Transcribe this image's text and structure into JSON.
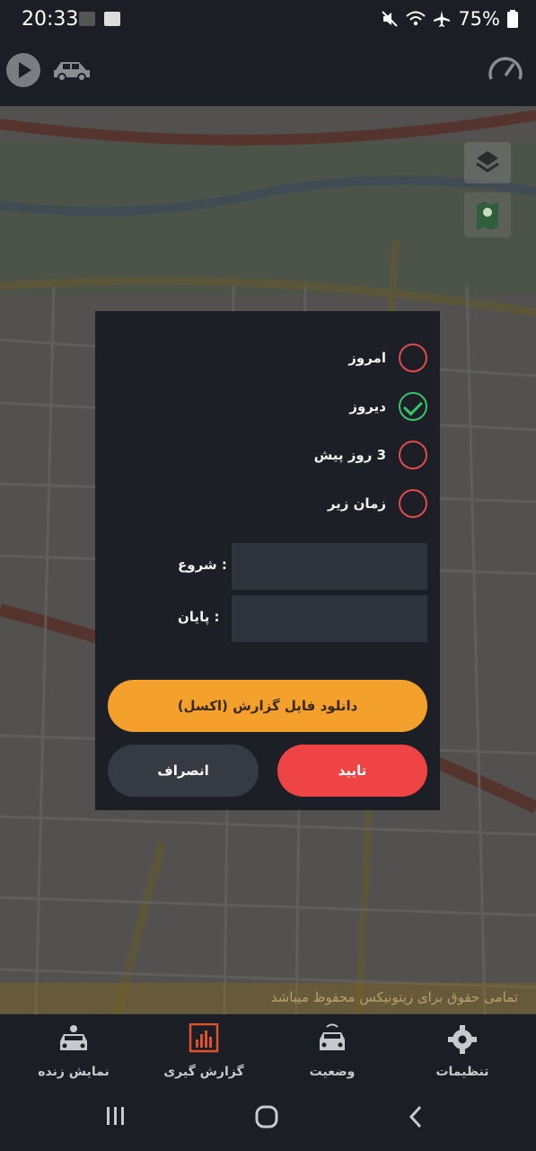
{
  "status_bar": {
    "time": "20:33",
    "battery": "75%"
  },
  "map": {
    "copyright": "تمامی حقوق برای زیتونیکس محفوظ میباشد"
  },
  "dialog": {
    "options": [
      {
        "label": "امروز",
        "checked": false
      },
      {
        "label": "دیروز",
        "checked": true
      },
      {
        "label": "3 روز پیش",
        "checked": false
      },
      {
        "label": "زمان زیر",
        "checked": false
      }
    ],
    "start_label": ": شروع",
    "start_value": "",
    "end_label": ": پایان",
    "end_value": "",
    "download_label": "دانلود فایل گزارش (اکسل)",
    "cancel_label": "انصراف",
    "confirm_label": "تایید",
    "colors": {
      "accent_orange": "#f4a02d",
      "confirm_red": "#ef4445",
      "check_green": "#36c36b"
    }
  },
  "bottom_nav": {
    "items": [
      {
        "label": "تنظیمات",
        "icon": "gear-icon"
      },
      {
        "label": "وضعیت",
        "icon": "car-status-icon"
      },
      {
        "label": "گزارش گیری",
        "icon": "report-chart-icon",
        "active": true
      },
      {
        "label": "نمایش زنده",
        "icon": "live-car-icon"
      }
    ]
  }
}
